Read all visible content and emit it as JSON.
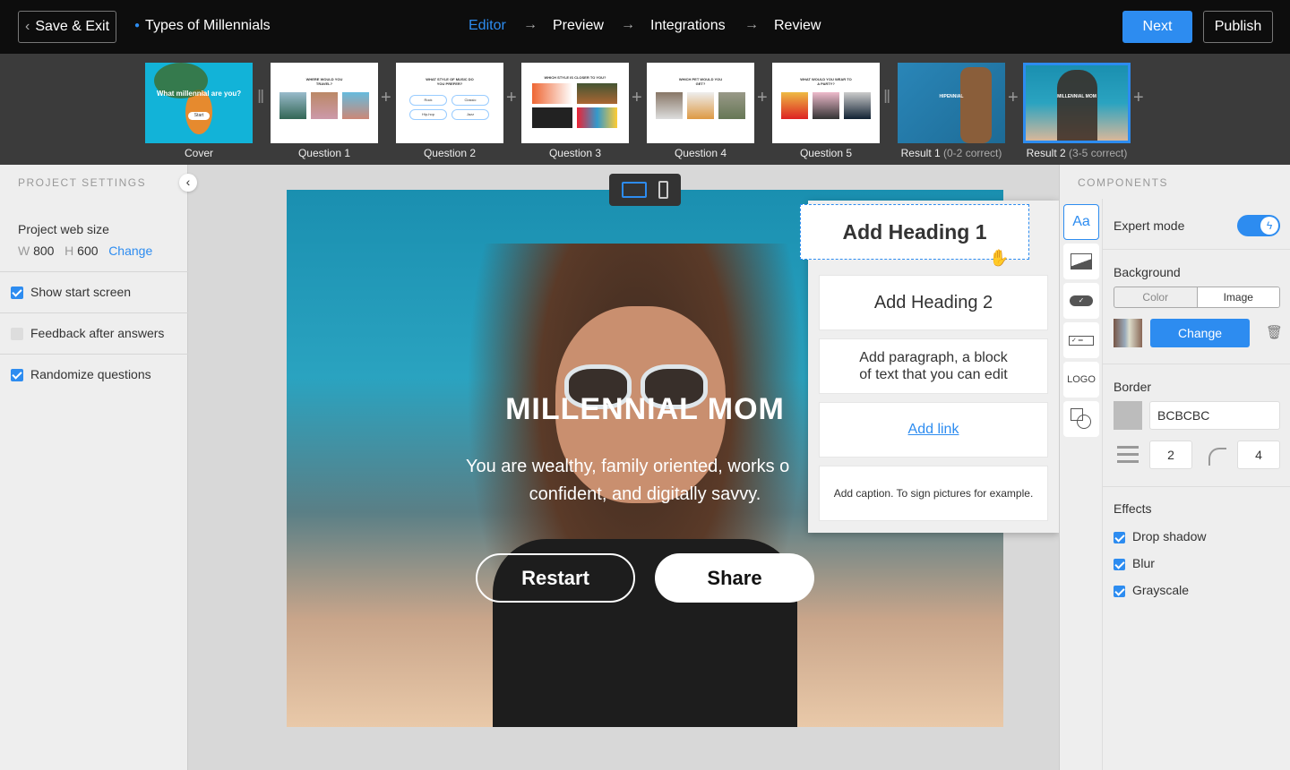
{
  "topbar": {
    "save_exit": "Save & Exit",
    "project_title": "Types of Millennials",
    "steps": [
      "Editor",
      "Preview",
      "Integrations",
      "Review"
    ],
    "next": "Next",
    "publish": "Publish"
  },
  "strip": {
    "slides": [
      {
        "label": "Cover",
        "sub": "",
        "title": "What millennial are you?",
        "button": "Start"
      },
      {
        "label": "Question 1",
        "sub": "",
        "title": "WHERE WOULD YOU TRAVEL?"
      },
      {
        "label": "Question 2",
        "sub": "",
        "title": "WHAT STYLE OF MUSIC DO YOU PREFER?",
        "options": [
          "Rock",
          "Classic",
          "Hip-hop",
          "Jazz"
        ]
      },
      {
        "label": "Question 3",
        "sub": "",
        "title": "WHICH STYLE IS CLOSER TO YOU?"
      },
      {
        "label": "Question 4",
        "sub": "",
        "title": "WHICH PET WOULD YOU GET?"
      },
      {
        "label": "Question 5",
        "sub": "",
        "title": "WHAT WOULD YOU WEAR TO A PARTY?"
      },
      {
        "label": "Result 1",
        "sub": "(0-2 correct)",
        "title": "HIPENNIAL"
      },
      {
        "label": "Result 2",
        "sub": "(3-5 correct)",
        "title": "MILLENNIAL MOM"
      }
    ]
  },
  "left": {
    "header": "PROJECT SETTINGS",
    "web_size_label": "Project web size",
    "w_label": "W",
    "w": "800",
    "h_label": "H",
    "h": "600",
    "change": "Change",
    "options": [
      {
        "label": "Show start screen",
        "checked": true
      },
      {
        "label": "Feedback after answers",
        "checked": false
      },
      {
        "label": "Randomize questions",
        "checked": true
      }
    ]
  },
  "preview": {
    "title": "MILLENNIAL MOM",
    "text": "You are wealthy, family oriented, works o\nconfident, and digitally savvy.",
    "line1": "You are wealthy, family oriented, works o",
    "line2": "confident, and digitally savvy.",
    "restart": "Restart",
    "share": "Share"
  },
  "components": {
    "heading1": "Add Heading 1",
    "heading2": "Add Heading 2",
    "paragraph_line1": "Add paragraph, a block",
    "paragraph_line2": "of text that you can edit",
    "link": "Add link",
    "caption": "Add caption. To sign pictures for example."
  },
  "right": {
    "header": "COMPONENTS",
    "expert_mode": "Expert mode",
    "expert_on": true,
    "background": "Background",
    "bg_tabs": [
      "Color",
      "Image"
    ],
    "bg_selected": "Image",
    "change": "Change",
    "border": "Border",
    "border_color": "BCBCBC",
    "border_width": "2",
    "border_radius": "4",
    "effects": "Effects",
    "effect_items": [
      {
        "label": "Drop shadow",
        "checked": true
      },
      {
        "label": "Blur",
        "checked": true
      },
      {
        "label": "Grayscale",
        "checked": true
      }
    ],
    "icons": [
      "text-icon",
      "image-icon",
      "button-icon",
      "form-icon",
      "logo-icon",
      "shapes-icon"
    ],
    "logo_text": "LOGO",
    "text_icon_label": "Aa"
  },
  "colors": {
    "accent": "#2d8cf0",
    "topbar": "#0d0d0d",
    "strip": "#3b3b3b"
  }
}
